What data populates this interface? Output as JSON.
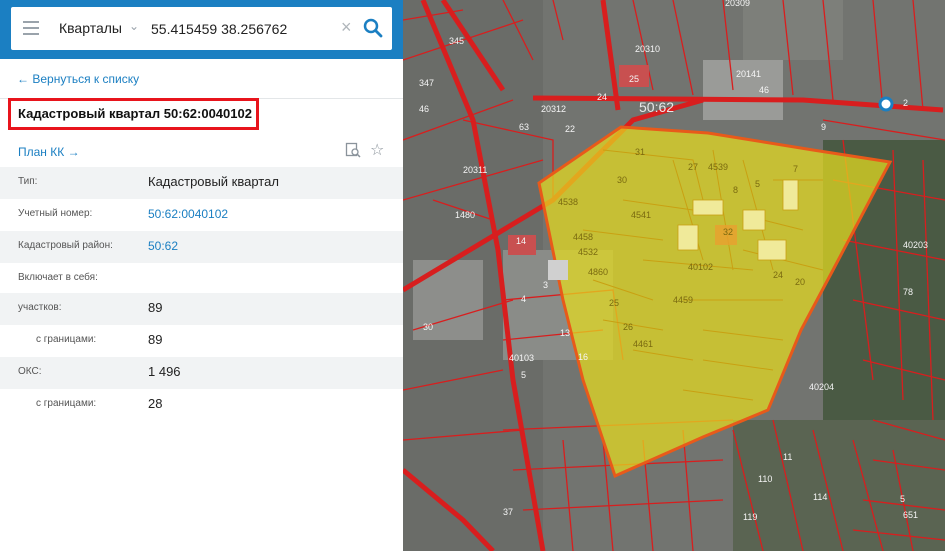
{
  "search": {
    "layer": "Кварталы",
    "query": "55.415459 38.256762"
  },
  "panel": {
    "back_link": "Вернуться к списку",
    "title": "Кадастровый квартал 50:62:0040102",
    "plan_link": "План КК",
    "rows": [
      {
        "label": "Тип:",
        "value": "Кадастровый квартал"
      },
      {
        "label": "Учетный номер:",
        "value": "50:62:0040102"
      },
      {
        "label": "Кадастровый район:",
        "value": "50:62"
      },
      {
        "label": "Включает в себя:",
        "value": ""
      },
      {
        "label": "участков:",
        "value": "89"
      },
      {
        "label": "с границами:",
        "value": "89"
      },
      {
        "label": "ОКС:",
        "value": "1 496"
      },
      {
        "label": "с границами:",
        "value": "28"
      }
    ]
  },
  "map": {
    "labels": [
      "20309",
      "20310",
      "20141",
      "46",
      "20312",
      "25",
      "24",
      "22",
      "50:62",
      "345",
      "347",
      "20311",
      "1480",
      "31",
      "30",
      "4538",
      "4541",
      "4539",
      "27",
      "7",
      "5",
      "8",
      "32",
      "40102",
      "4458",
      "4532",
      "4860",
      "14",
      "25",
      "4459",
      "26",
      "4461",
      "40103",
      "13",
      "16",
      "4",
      "3",
      "30",
      "5",
      "20",
      "24",
      "40203",
      "78",
      "40204",
      "11",
      "110",
      "114",
      "651",
      "5",
      "37",
      "119",
      "46",
      "9",
      "63",
      "2"
    ],
    "colors": {
      "highlight_fill": "#e6dc1e",
      "highlight_stroke": "#e85a1a",
      "parcel_line": "#d81e1e",
      "label": "#f5f5f5"
    }
  }
}
